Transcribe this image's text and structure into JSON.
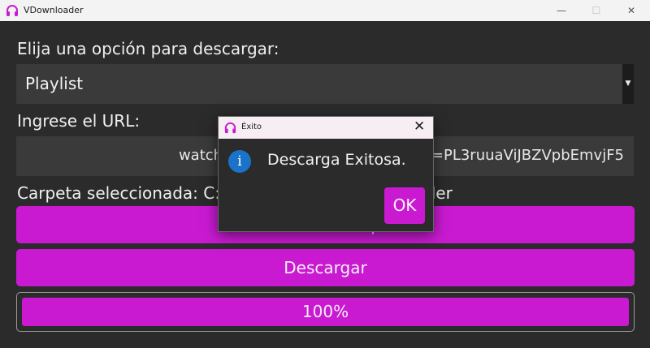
{
  "window": {
    "title": "VDownloader",
    "minimize_glyph": "—",
    "maximize_glyph": "☐",
    "close_glyph": "✕"
  },
  "form": {
    "option_label": "Elija una opción para descargar:",
    "option_selected": "Playlist",
    "url_label": "Ingrese el URL:",
    "url_value": "watch?v=QvkKGV5p8zvUlZnb&list=PL3ruuaViJBZVpbEmvjF5",
    "folder_label": "Carpeta seleccionada: C:/Users/Usuario/VDownloader",
    "select_folder_button": "Seleccionar Carpeta",
    "download_button": "Descargar",
    "progress_percent": 100,
    "progress_text": "100%"
  },
  "dialog": {
    "title": "Éxito",
    "message": "Descarga Exitosa.",
    "ok_label": "OK",
    "close_glyph": "✕",
    "info_glyph": "i"
  },
  "colors": {
    "accent": "#c91ad2",
    "background": "#2b2b2b",
    "input_bg": "#3a3a3a",
    "info_blue": "#1a73c8"
  },
  "icons": {
    "app": "headphones-icon",
    "dialog": "headphones-icon",
    "info": "info-icon"
  }
}
